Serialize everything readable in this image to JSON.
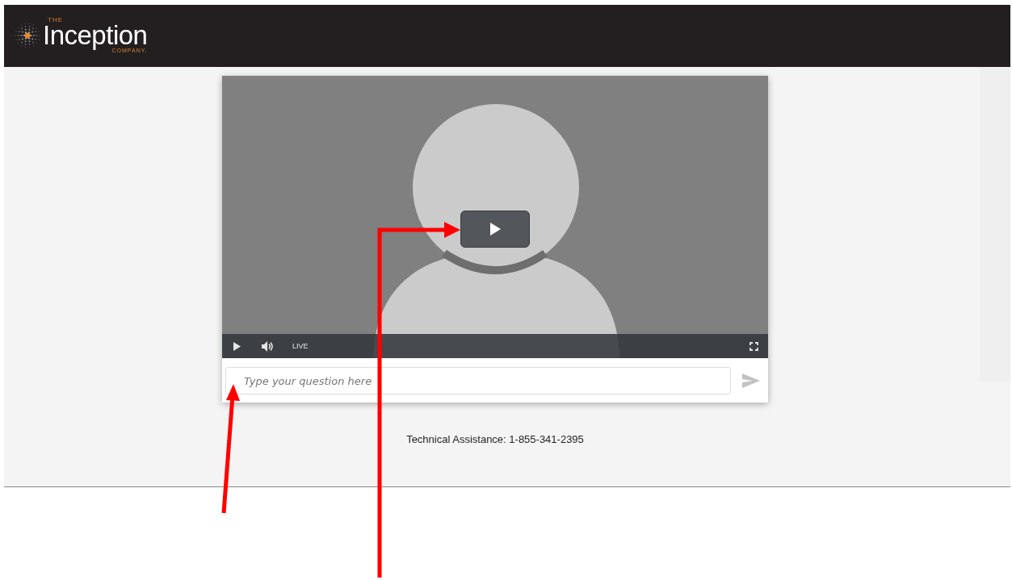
{
  "header": {
    "logo": {
      "top": "THE",
      "name": "Inception",
      "bottom": "COMPANY."
    }
  },
  "player": {
    "live_label": "LIVE"
  },
  "question": {
    "placeholder": "Type your question here"
  },
  "footer": {
    "text": "Technical Assistance: 1-855-341-2395"
  }
}
